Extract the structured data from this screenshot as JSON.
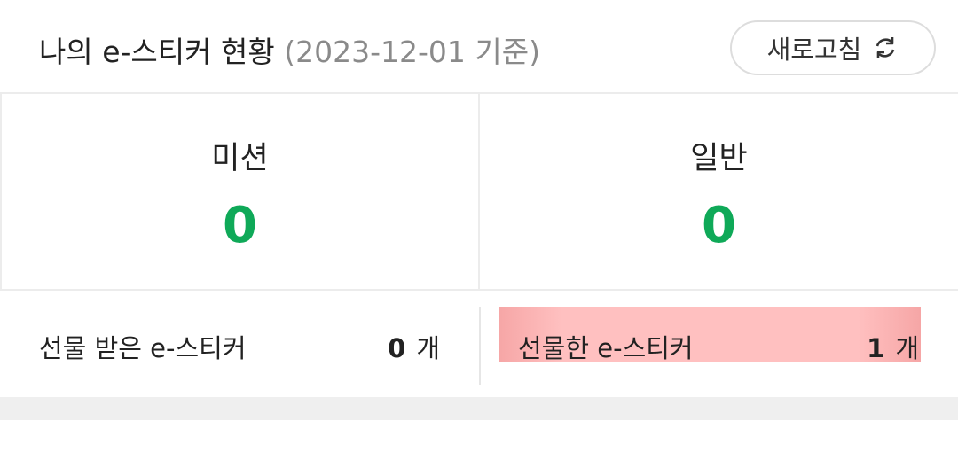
{
  "header": {
    "title": "나의 e-스티커 현황",
    "date_note": "(2023-12-01 기준)",
    "refresh_label": "새로고침",
    "refresh_icon": "refresh-icon"
  },
  "stats": {
    "mission": {
      "label": "미션",
      "value": "0"
    },
    "general": {
      "label": "일반",
      "value": "0"
    },
    "value_color": "#0fa958"
  },
  "gifts": {
    "received": {
      "label": "선물 받은 e-스티커",
      "count": "0",
      "unit": "개"
    },
    "sent": {
      "label": "선물한 e-스티커",
      "count": "1",
      "unit": "개"
    }
  }
}
